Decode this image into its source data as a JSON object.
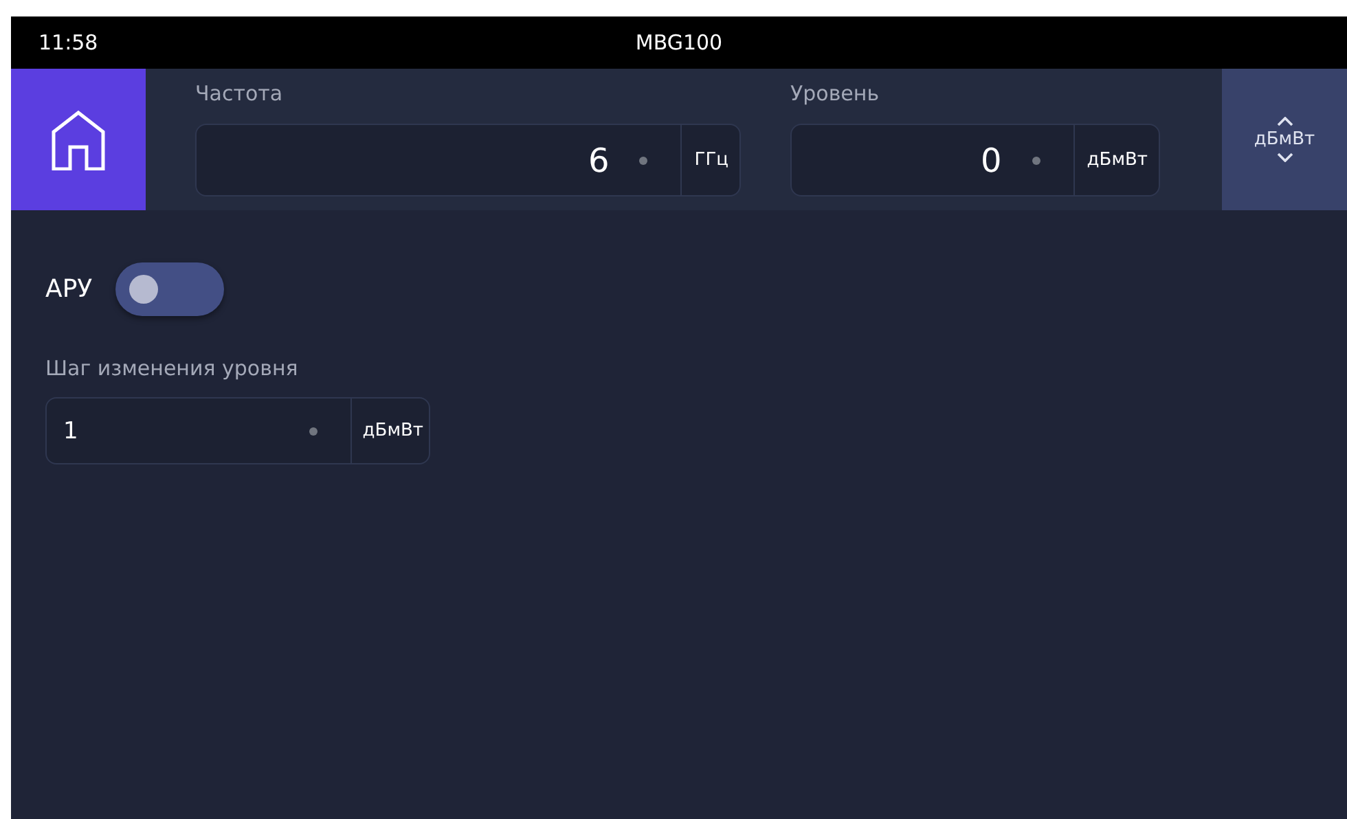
{
  "status_bar": {
    "time": "11:58",
    "title": "MBG100"
  },
  "header": {
    "fields": [
      {
        "label": "Частота",
        "value": "6",
        "unit": "ГГц"
      },
      {
        "label": "Уровень",
        "value": "0",
        "unit": "дБмВт"
      }
    ],
    "unit_switch": {
      "label": "дБмВт"
    }
  },
  "agc": {
    "label": "АРУ",
    "on": false
  },
  "step": {
    "label": "Шаг изменения уровня",
    "value": "1",
    "unit": "дБмВт"
  }
}
